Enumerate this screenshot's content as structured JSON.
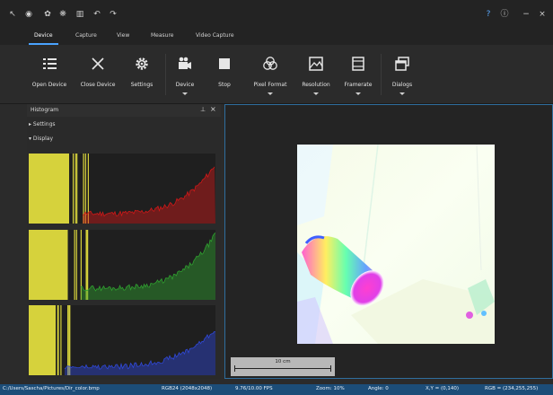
{
  "quick_access": [
    {
      "name": "back-arrow-icon",
      "glyph": "↖"
    },
    {
      "name": "camera-dropdown-icon",
      "glyph": "◉"
    },
    {
      "name": "settings-gear-icon",
      "glyph": "✿"
    },
    {
      "name": "color-wheel-icon",
      "glyph": "❋"
    },
    {
      "name": "histogram-icon",
      "glyph": "▥"
    },
    {
      "name": "undo-icon",
      "glyph": "↶"
    },
    {
      "name": "redo-icon",
      "glyph": "↷"
    }
  ],
  "window_buttons": [
    {
      "name": "help-icon",
      "glyph": "?"
    },
    {
      "name": "info-icon",
      "glyph": "ⓘ"
    },
    {
      "name": "minimize-icon",
      "glyph": "−"
    },
    {
      "name": "close-window-icon",
      "glyph": "×"
    }
  ],
  "tabs": [
    "Device",
    "Capture",
    "View",
    "Measure",
    "Video Capture"
  ],
  "active_tab": "Device",
  "ribbon": {
    "open_device": "Open Device",
    "close_device": "Close Device",
    "settings": "Settings",
    "device": "Device",
    "stop": "Stop",
    "pixel_format": "Pixel Format",
    "resolution": "Resolution",
    "framerate": "Framerate",
    "dialogs": "Dialogs"
  },
  "histogram": {
    "title": "Histogram",
    "pin": "⊥",
    "close": "×",
    "settings_label": "Settings",
    "display_label": "Display",
    "channels": [
      "red",
      "green",
      "blue"
    ],
    "colors": {
      "red": "#d01818",
      "green": "#2fa02f",
      "blue": "#2f48d8",
      "clip": "#d6d23c"
    }
  },
  "viewer": {
    "scale_label": "10 cm"
  },
  "status": {
    "path": "C:/Users/Sascha/Pictures/Dir_color.bmp",
    "format": "RGB24 (2048x2048)",
    "fps": "9.76/10.00 FPS",
    "zoom": "Zoom: 10%",
    "angle": "Angle: 0",
    "xy": "X,Y = (0,140)",
    "rgb": "RGB = (234,255,255)"
  }
}
